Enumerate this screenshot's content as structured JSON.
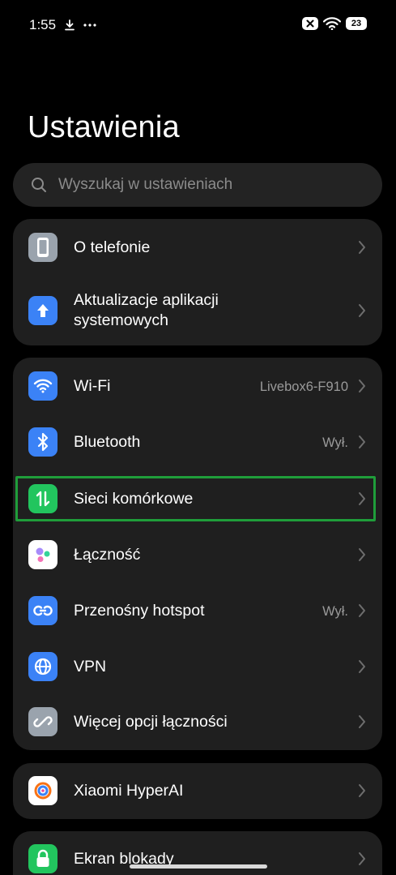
{
  "status": {
    "time": "1:55",
    "battery": "23"
  },
  "page": {
    "title": "Ustawienia"
  },
  "search": {
    "placeholder": "Wyszukaj w ustawieniach"
  },
  "cards": {
    "device": [
      {
        "label": "O telefonie",
        "icon": "phone-icon"
      },
      {
        "label": "Aktualizacje aplikacji systemowych",
        "line1": "Aktualizacje aplikacji",
        "line2": "systemowych",
        "icon": "arrow-up-icon"
      }
    ],
    "network": [
      {
        "label": "Wi-Fi",
        "value": "Livebox6-F910",
        "icon": "wifi-icon"
      },
      {
        "label": "Bluetooth",
        "value": "Wył.",
        "icon": "bluetooth-icon"
      },
      {
        "label": "Sieci komórkowe",
        "icon": "mobile-data-icon"
      },
      {
        "label": "Łączność",
        "icon": "connectivity-icon"
      },
      {
        "label": "Przenośny hotspot",
        "value": "Wył.",
        "icon": "hotspot-icon"
      },
      {
        "label": "VPN",
        "icon": "globe-icon"
      },
      {
        "label": "Więcej opcji łączności",
        "icon": "link-icon"
      }
    ],
    "ai": [
      {
        "label": "Xiaomi HyperAI",
        "icon": "hyperai-icon"
      }
    ],
    "lock": [
      {
        "label": "Ekran blokady",
        "icon": "lock-icon"
      }
    ]
  },
  "colors": {
    "background": "#000000",
    "card": "#1f1f1f",
    "blue_icon": "#3b82f6",
    "green_icon": "#22c55e",
    "highlight": "#1f9d3a"
  }
}
